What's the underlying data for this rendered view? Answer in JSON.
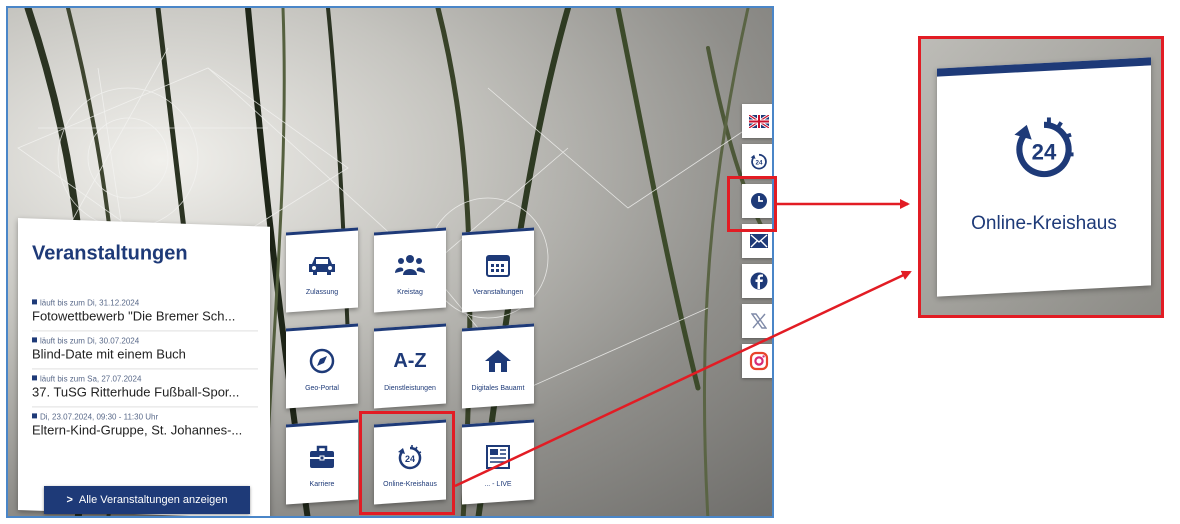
{
  "events": {
    "title": "Veranstaltungen",
    "items": [
      {
        "date": "läuft bis zum Di, 31.12.2024",
        "title": "Fotowettbewerb \"Die Bremer Sch..."
      },
      {
        "date": "läuft bis zum Di, 30.07.2024",
        "title": "Blind-Date mit einem Buch"
      },
      {
        "date": "läuft bis zum Sa, 27.07.2024",
        "title": "37. TuSG Ritterhude Fußball-Spor..."
      },
      {
        "date": "Di, 23.07.2024, 09:30 - 11:30 Uhr",
        "title": "Eltern-Kind-Gruppe, St. Johannes-..."
      }
    ],
    "all_button": "Alle Veranstaltungen anzeigen"
  },
  "tiles": [
    {
      "label": "Zulassung",
      "icon": "car-icon"
    },
    {
      "label": "Kreistag",
      "icon": "people-icon"
    },
    {
      "label": "Veranstaltungen",
      "icon": "calendar-icon"
    },
    {
      "label": "Geo-Portal",
      "icon": "compass-icon"
    },
    {
      "label": "Dienstleistungen",
      "icon": "az-icon",
      "text": "A-Z"
    },
    {
      "label": "Digitales Bauamt",
      "icon": "house-icon"
    },
    {
      "label": "Karriere",
      "icon": "briefcase-icon"
    },
    {
      "label": "Online-Kreishaus",
      "icon": "24h-icon"
    },
    {
      "label": "... - LIVE",
      "icon": "newspaper-icon"
    }
  ],
  "sidebar": [
    "uk-flag-icon",
    "24h-icon",
    "clock-icon",
    "mail-icon",
    "facebook-icon",
    "x-icon",
    "instagram-icon"
  ],
  "zoom": {
    "label": "Online-Kreishaus",
    "icon": "24h-icon"
  },
  "colors": {
    "brand": "#1e3a78",
    "highlight": "#e21c24",
    "frame": "#4a86c8"
  }
}
